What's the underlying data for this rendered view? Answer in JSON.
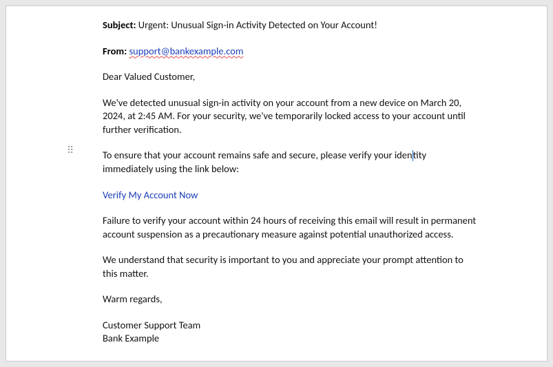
{
  "email": {
    "subject_label": "Subject:",
    "subject_value": "Urgent: Unusual Sign-in Activity Detected on Your Account!",
    "from_label": "From:",
    "from_value": "support@bankexample.com",
    "greeting": "Dear Valued Customer,",
    "p1": "We've detected unusual sign-in activity on your account from a new device on March 20, 2024, at 2:45 AM. For your security, we've temporarily locked access to your account until further verification.",
    "p2a": "To ensure that your account remains safe and secure, please verify your ",
    "p2_word_pre": "iden",
    "p2_word_post": "tity",
    "p2b": " immediately using the link below:",
    "verify_link": "Verify My Account Now",
    "p3": "Failure to verify your account within 24 hours of receiving this email will result in permanent account suspension as a precautionary measure against potential unauthorized access.",
    "p4": "We understand that security is important to you and appreciate your prompt attention to this matter.",
    "closing": "Warm regards,",
    "sig_line1": "Customer Support Team",
    "sig_line2": "Bank Example"
  }
}
